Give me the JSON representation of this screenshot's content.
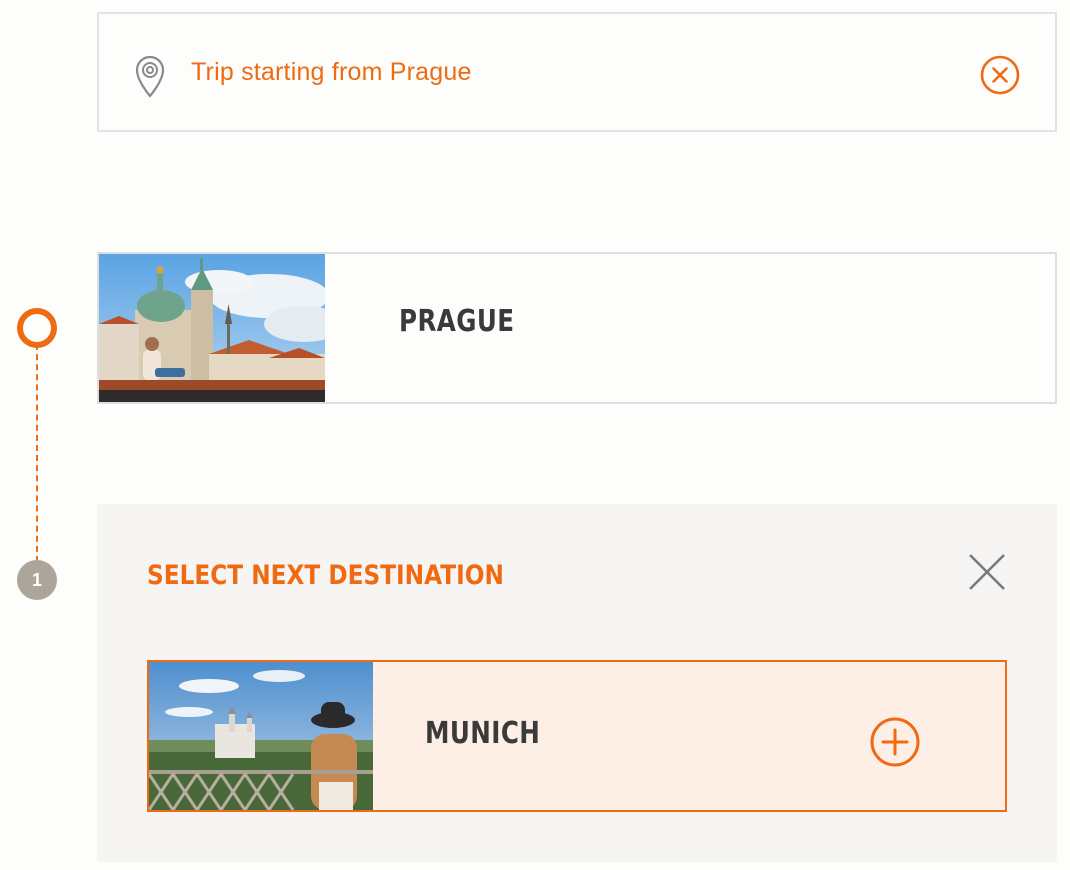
{
  "start": {
    "label": "Trip starting from Prague",
    "pin_icon": "location-pin-icon",
    "clear_icon": "circle-x-icon"
  },
  "timeline": {
    "step_number": "1"
  },
  "current_city": {
    "name": "PRAGUE"
  },
  "select_panel": {
    "title": "SELECT NEXT DESTINATION",
    "close_icon": "close-x-icon",
    "options": [
      {
        "name": "MUNICH",
        "add_icon": "circle-plus-icon"
      }
    ]
  },
  "colors": {
    "accent": "#f06a12",
    "text_dark": "#3a3a3a",
    "panel_bg": "#f6f5f4",
    "option_bg": "#fdeee6",
    "badge_gray": "#aba59b"
  }
}
